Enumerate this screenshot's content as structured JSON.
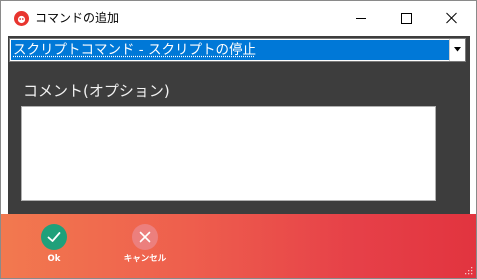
{
  "window": {
    "title": "コマンドの追加",
    "controls": {
      "minimize_icon": "minimize-icon",
      "maximize_icon": "maximize-icon",
      "close_icon": "close-icon"
    }
  },
  "command_select": {
    "selected": "スクリプトコマンド - スクリプトの停止"
  },
  "comment": {
    "label": "コメント(オプション)",
    "value": ""
  },
  "actions": {
    "ok_label": "Ok",
    "cancel_label": "キャンセル"
  },
  "colors": {
    "content_bg": "#3d3d3d",
    "selection": "#0078d7",
    "footer_start": "#f2794f",
    "footer_end": "#e2343f",
    "ok": "#20a07a",
    "cancel": "#ec7f7d"
  }
}
